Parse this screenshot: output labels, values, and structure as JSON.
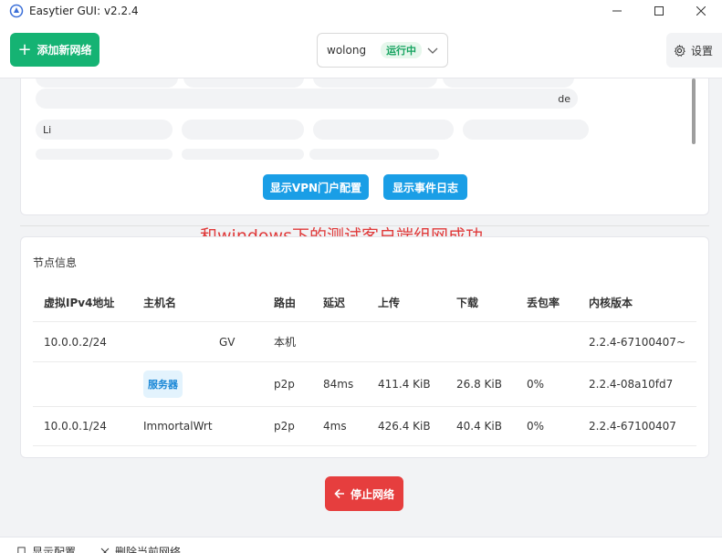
{
  "window": {
    "title": "Easytier GUI: v2.2.4"
  },
  "toolbar": {
    "add_network_label": "添加新网络",
    "network_name": "wolong",
    "network_status": "运行中",
    "settings_label": "设置"
  },
  "peers_panel": {
    "chips_row1": [
      "",
      "",
      "",
      ""
    ],
    "chips_row2": [
      "de"
    ],
    "chips_row3": [
      "Li",
      "",
      "",
      "",
      ""
    ],
    "chips_row4": [
      "",
      "",
      ""
    ],
    "vpn_portal_button": "显示VPN门户配置",
    "event_log_button": "显示事件日志"
  },
  "annotation": "和windows下的测试客户端组网成功",
  "nodes": {
    "title": "节点信息",
    "columns": [
      "虚拟IPv4地址",
      "主机名",
      "路由",
      "延迟",
      "上传",
      "下载",
      "丢包率",
      "内核版本"
    ],
    "rows": [
      {
        "ipv4": "10.0.0.2/24",
        "hostname": "GV",
        "route": "本机",
        "latency": "",
        "upload": "",
        "download": "",
        "loss": "",
        "version": "2.2.4-67100407~"
      },
      {
        "ipv4": "",
        "hostname": "服务器",
        "route": "p2p",
        "latency": "84ms",
        "upload": "411.4 KiB",
        "download": "26.8 KiB",
        "loss": "0%",
        "version": "2.2.4-08a10fd7"
      },
      {
        "ipv4": "10.0.0.1/24",
        "hostname": "ImmortalWrt",
        "route": "p2p",
        "latency": "4ms",
        "upload": "426.4 KiB",
        "download": "40.4 KiB",
        "loss": "0%",
        "version": "2.2.4-67100407"
      }
    ]
  },
  "stop_button": "停止网络",
  "bottom": {
    "show_config": "显示配置",
    "delete_network": "删除当前网络"
  }
}
